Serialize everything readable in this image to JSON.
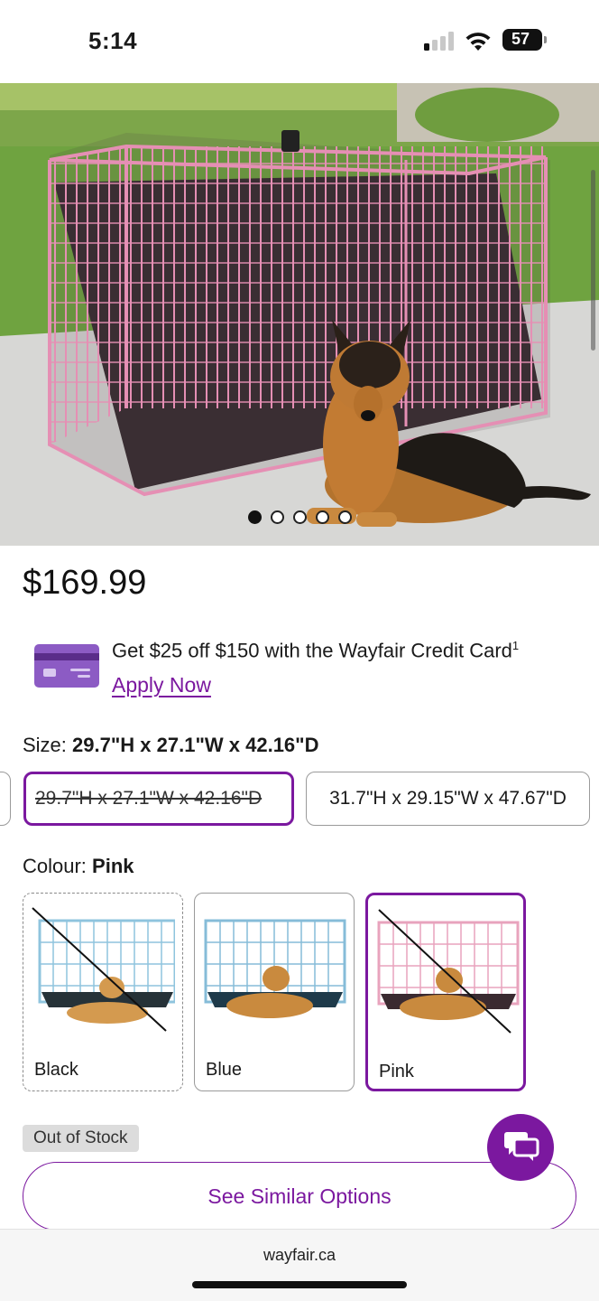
{
  "status_bar": {
    "time": "5:14",
    "battery": "57"
  },
  "product": {
    "image_alt": "Pink wire dog crate with German Shepherd",
    "carousel_total": 5,
    "carousel_active": 1,
    "price": "$169.99"
  },
  "promo": {
    "text": "Get $25 off $150 with the Wayfair Credit Card",
    "footnote": "1",
    "apply_label": "Apply Now"
  },
  "size": {
    "label": "Size:",
    "selected": "29.7\"H x 27.1\"W x 42.16\"D",
    "options": [
      {
        "label": "29.7\"H x 27.1\"W x 42.16\"D",
        "selected": true,
        "available": false
      },
      {
        "label": "31.7\"H x 29.15\"W x 47.67\"D",
        "selected": false,
        "available": true
      }
    ]
  },
  "colour": {
    "label": "Colour:",
    "selected": "Pink",
    "options": [
      {
        "label": "Black",
        "available": false,
        "selected": false,
        "crate_color": "#8fc4de",
        "tray_color": "#263238"
      },
      {
        "label": "Blue",
        "available": true,
        "selected": false,
        "crate_color": "#86bcd8",
        "tray_color": "#1e3a4a"
      },
      {
        "label": "Pink",
        "available": false,
        "selected": true,
        "crate_color": "#e8a3bd",
        "tray_color": "#3a2a30"
      }
    ]
  },
  "stock_badge": "Out of Stock",
  "similar_button": "See Similar Options",
  "footer": {
    "url": "wayfair.ca"
  },
  "colors": {
    "accent": "#7b189f",
    "card": "#8c5bc4"
  },
  "icons": [
    "cellular-signal-icon",
    "wifi-icon",
    "battery-icon",
    "credit-card-icon",
    "chat-icon"
  ]
}
